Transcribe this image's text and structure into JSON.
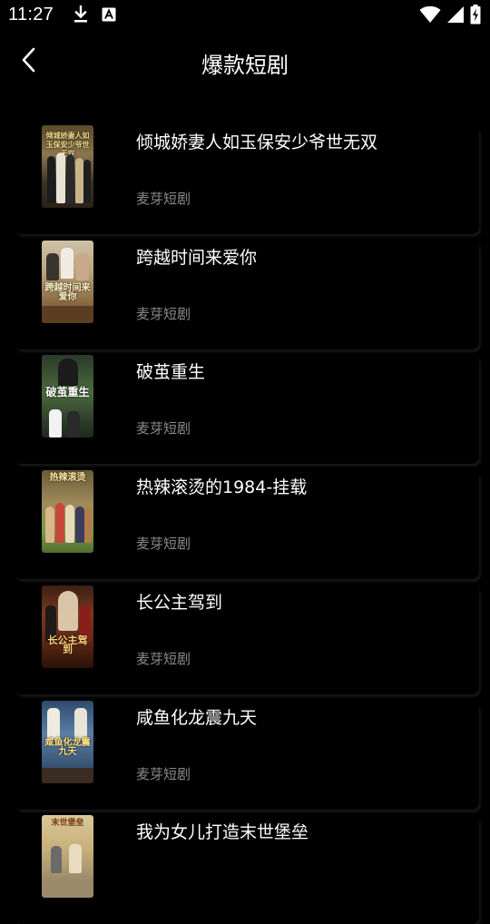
{
  "status_bar": {
    "time": "11:27",
    "left_icons": [
      "download-icon",
      "font-a-icon"
    ],
    "right_icons": [
      "wifi-icon",
      "cell-signal-icon",
      "battery-charging-icon"
    ]
  },
  "header": {
    "back_icon": "chevron-left-icon",
    "title": "爆款短剧"
  },
  "items": [
    {
      "title": "倾城娇妻人如玉保安少爷世无双",
      "source": "麦芽短剧",
      "cover_text": "倾城娇妻人如玉保安少爷世无双"
    },
    {
      "title": "跨越时间来爱你",
      "source": "麦芽短剧",
      "cover_text": "跨越时间来爱你"
    },
    {
      "title": "破茧重生",
      "source": "麦芽短剧",
      "cover_text": "破茧重生"
    },
    {
      "title": "热辣滚烫的1984-挂载",
      "source": "麦芽短剧",
      "cover_text": "热辣滚烫"
    },
    {
      "title": "长公主驾到",
      "source": "麦芽短剧",
      "cover_text": "长公主驾到"
    },
    {
      "title": "咸鱼化龙震九天",
      "source": "麦芽短剧",
      "cover_text": "咸鱼化龙震九天"
    },
    {
      "title": "我为女儿打造末世堡垒",
      "source": "",
      "cover_text": "末世堡垒"
    }
  ],
  "colors": {
    "background": "#000000",
    "title_text": "#ffffff",
    "source_text": "#8a8a8a"
  }
}
